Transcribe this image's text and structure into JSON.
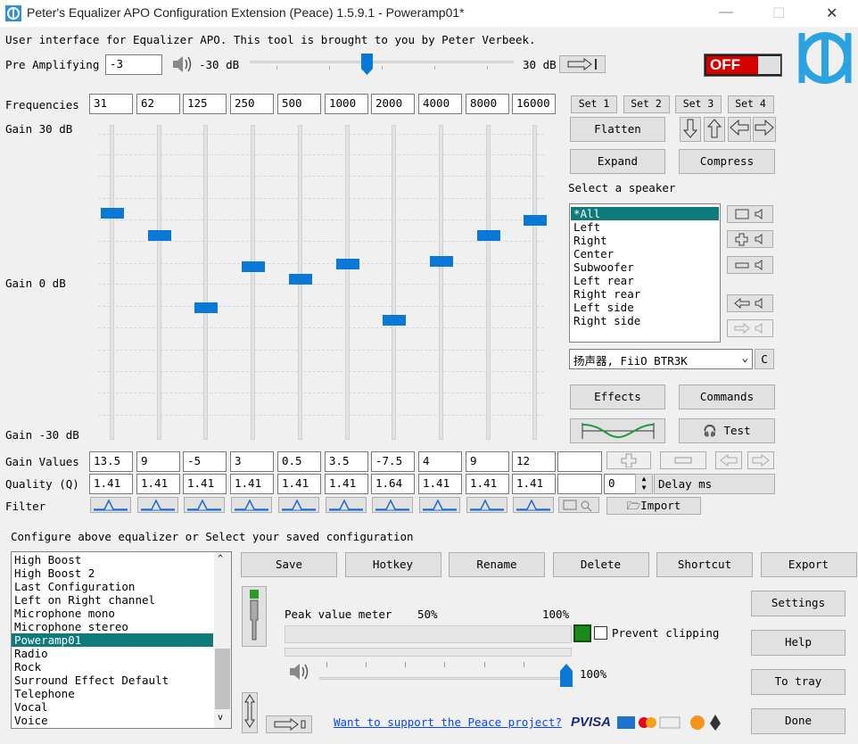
{
  "window": {
    "title": "Peter's Equalizer APO Configuration Extension (Peace) 1.5.9.1 - Poweramp01*",
    "minimize": "—",
    "maximize": "☐",
    "close": "✕"
  },
  "intro": "User interface for Equalizer APO. This tool is brought to you by Peter Verbeek.",
  "preamp": {
    "label": "Pre Amplifying",
    "value": "-3",
    "min_label": "-30 dB",
    "max_label": "30 dB",
    "level_fraction": 0.44
  },
  "power": {
    "label": "OFF"
  },
  "labels": {
    "frequencies": "Frequencies",
    "gain_top": "Gain 30 dB",
    "gain_mid": "Gain 0 dB",
    "gain_bot": "Gain -30 dB",
    "gain_values": "Gain Values",
    "quality": "Quality (Q)",
    "filter": "Filter"
  },
  "bands": [
    {
      "freq": "31",
      "gain": "13.5",
      "q": "1.41",
      "gain_db": 13.5
    },
    {
      "freq": "62",
      "gain": "9",
      "q": "1.41",
      "gain_db": 9
    },
    {
      "freq": "125",
      "gain": "-5",
      "q": "1.41",
      "gain_db": -5
    },
    {
      "freq": "250",
      "gain": "3",
      "q": "1.41",
      "gain_db": 3
    },
    {
      "freq": "500",
      "gain": "0.5",
      "q": "1.41",
      "gain_db": 0.5
    },
    {
      "freq": "1000",
      "gain": "3.5",
      "q": "1.41",
      "gain_db": 3.5
    },
    {
      "freq": "2000",
      "gain": "-7.5",
      "q": "1.64",
      "gain_db": -7.5
    },
    {
      "freq": "4000",
      "gain": "4",
      "q": "1.41",
      "gain_db": 4
    },
    {
      "freq": "8000",
      "gain": "9",
      "q": "1.41",
      "gain_db": 9
    },
    {
      "freq": "16000",
      "gain": "12",
      "q": "1.41",
      "gain_db": 12
    }
  ],
  "sets": [
    "Set 1",
    "Set 2",
    "Set 3",
    "Set 4"
  ],
  "buttons": {
    "flatten": "Flatten",
    "expand": "Expand",
    "compress": "Compress",
    "effects": "Effects",
    "commands": "Commands",
    "test": "Test",
    "import": "Import",
    "delay_value": "0",
    "delay_label": "Delay ms",
    "device_c": "C"
  },
  "speaker": {
    "label": "Select a speaker",
    "items": [
      "*All",
      "Left",
      "Right",
      "Center",
      "Subwoofer",
      "Left rear",
      "Right rear",
      "Left side",
      "Right side"
    ],
    "selected": 0,
    "device": "扬声器, FiiO BTR3K"
  },
  "config": {
    "label": "Configure above equalizer or Select your saved configuration",
    "items": [
      "High Boost",
      "High Boost 2",
      "Last Configuration",
      "Left on Right channel",
      "Microphone mono",
      "Microphone stereo",
      "Poweramp01",
      "Radio",
      "Rock",
      "Surround Effect Default",
      "Telephone",
      "Vocal",
      "Voice"
    ],
    "selected": 6
  },
  "actions": [
    "Save",
    "Hotkey",
    "Rename",
    "Delete",
    "Shortcut",
    "Export"
  ],
  "side": [
    "Settings",
    "Help",
    "To tray",
    "Done"
  ],
  "meter": {
    "label": "Peak value meter",
    "p50": "50%",
    "p100": "100%",
    "prevent_clipping": "Prevent clipping",
    "volume": "100%",
    "volume_fraction": 1.0
  },
  "support": "Want to support the Peace project?",
  "payment": "PVISA",
  "colors": {
    "accent": "#0a78d7",
    "selection": "#0f7a7a",
    "link": "#0645ff",
    "off_red": "#d40000"
  },
  "icons": {
    "app": "peace-logo-icon",
    "speaker": "speaker-icon"
  }
}
